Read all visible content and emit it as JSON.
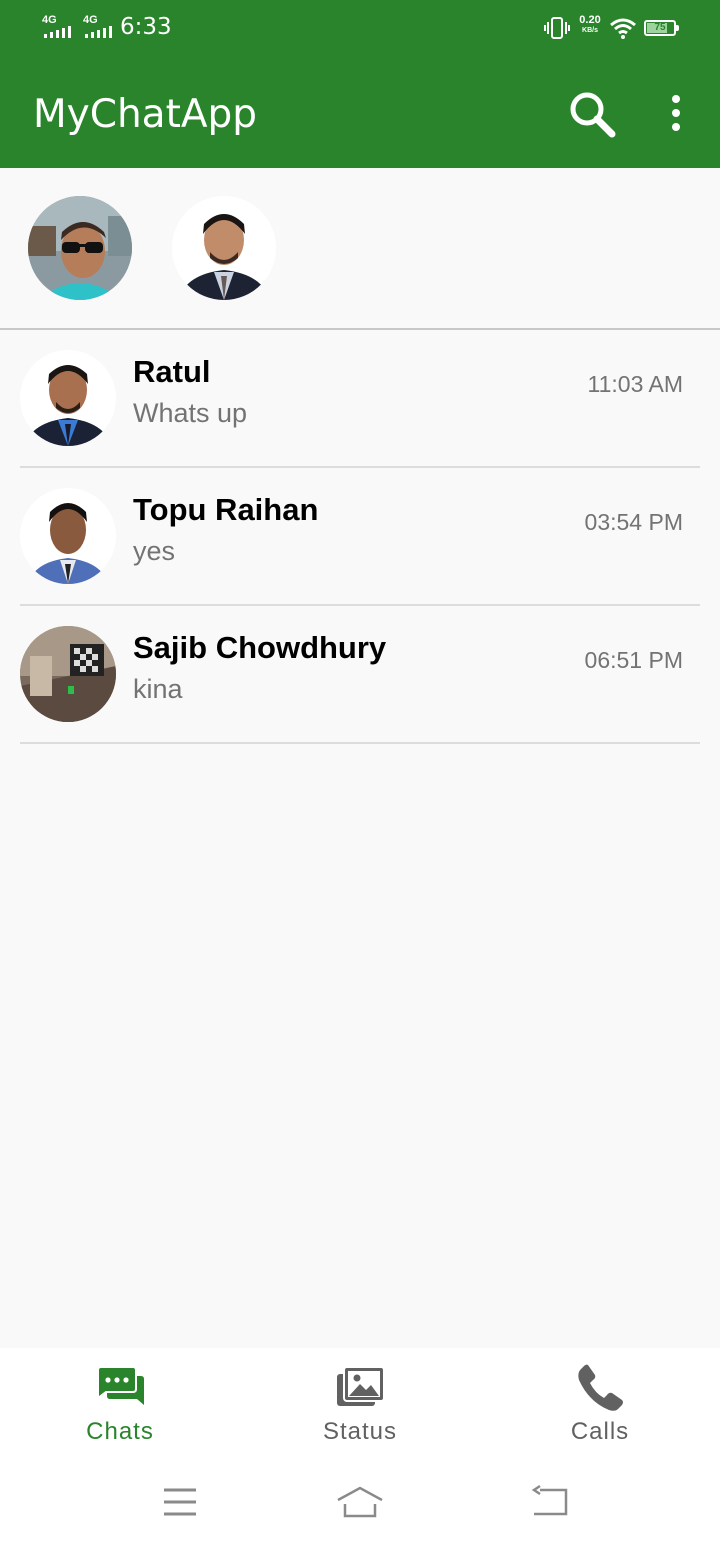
{
  "status_bar": {
    "network_1": "4G",
    "network_2": "4G",
    "time": "6:33",
    "speed_value": "0.20",
    "speed_unit": "KB/s",
    "battery_level": "75",
    "battery_fraction": 0.75
  },
  "app_bar": {
    "title": "MyChatApp",
    "search_icon": "search-icon",
    "more_icon": "more-vertical-icon"
  },
  "chats": [
    {
      "name": "Ratul",
      "message": "Whats up",
      "time": "11:03 AM"
    },
    {
      "name": "Topu Raihan",
      "message": "yes",
      "time": "03:54 PM"
    },
    {
      "name": "Sajib Chowdhury",
      "message": "kina",
      "time": "06:51 PM"
    }
  ],
  "bottom_nav": {
    "items": [
      {
        "label": "Chats",
        "icon": "chat-bubbles-icon",
        "active": true
      },
      {
        "label": "Status",
        "icon": "image-stack-icon",
        "active": false
      },
      {
        "label": "Calls",
        "icon": "phone-icon",
        "active": false
      }
    ]
  },
  "colors": {
    "primary": "#2a842b",
    "active_tab": "#2a842b",
    "inactive_tab": "#616161",
    "secondary_text": "#737373",
    "background": "#f9f9f9"
  }
}
